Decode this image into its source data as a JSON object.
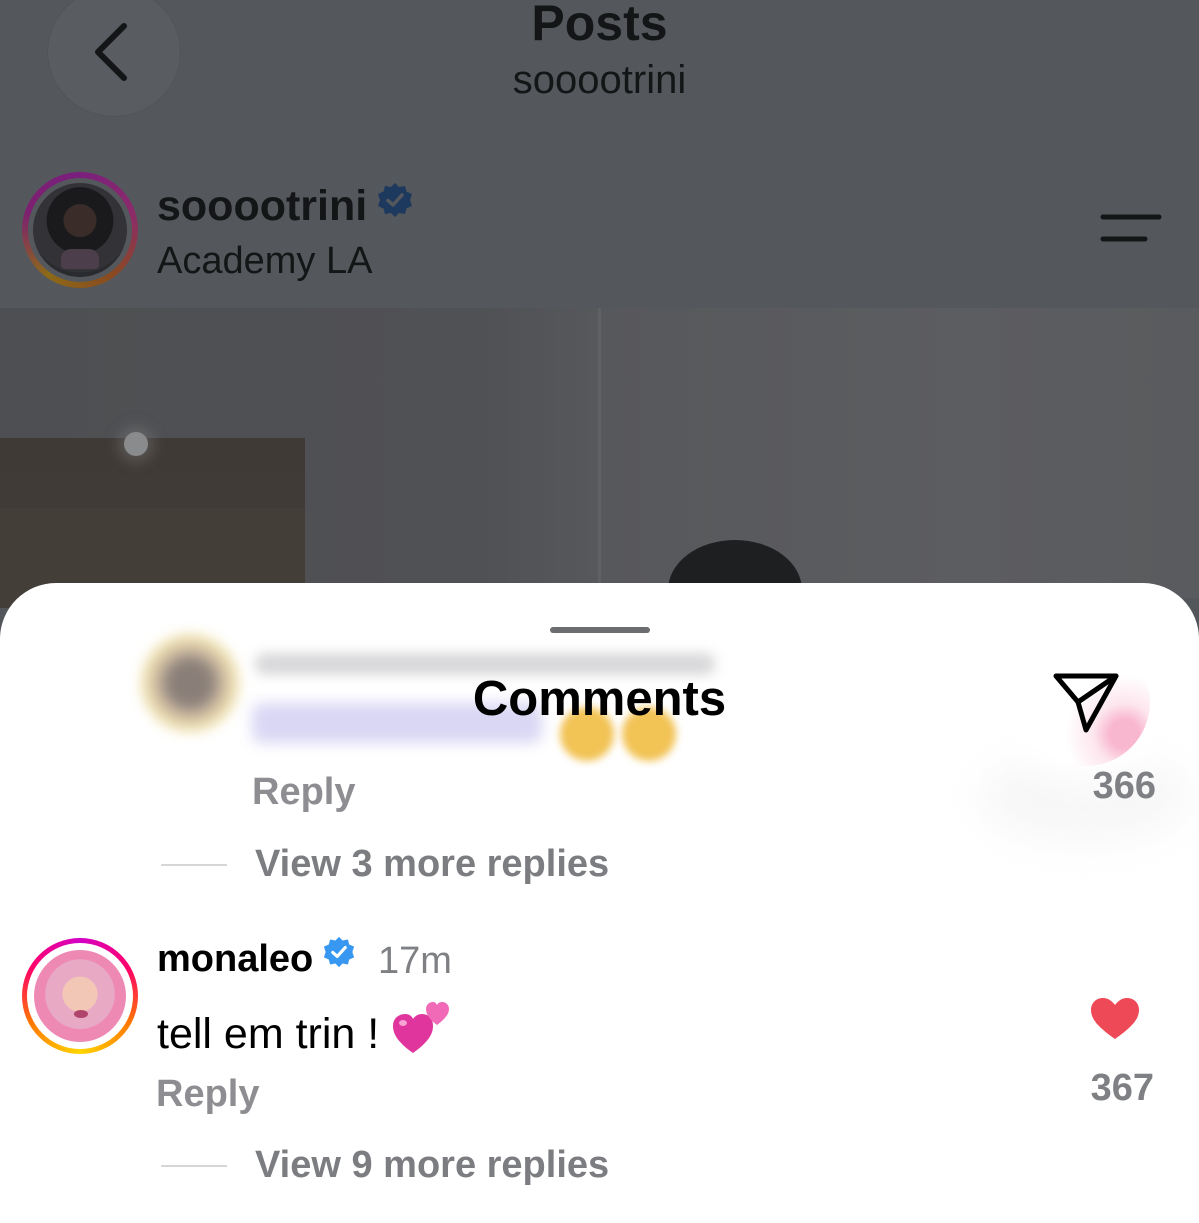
{
  "header": {
    "title": "Posts",
    "subtitle": "sooootrini"
  },
  "post": {
    "username": "sooootrini",
    "location": "Academy LA"
  },
  "comments_sheet": {
    "title": "Comments",
    "comment_1": {
      "username": "",
      "reply_label": "Reply",
      "like_count": "366",
      "view_replies": "View 3 more replies"
    },
    "comment_2": {
      "username": "monaleo",
      "time": "17m",
      "text": "tell em trin !",
      "reply_label": "Reply",
      "like_count": "367",
      "view_replies": "View 9 more replies",
      "liked": true
    }
  },
  "colors": {
    "verified_badge": "#3897f0",
    "like_heart": "#ed4956"
  }
}
